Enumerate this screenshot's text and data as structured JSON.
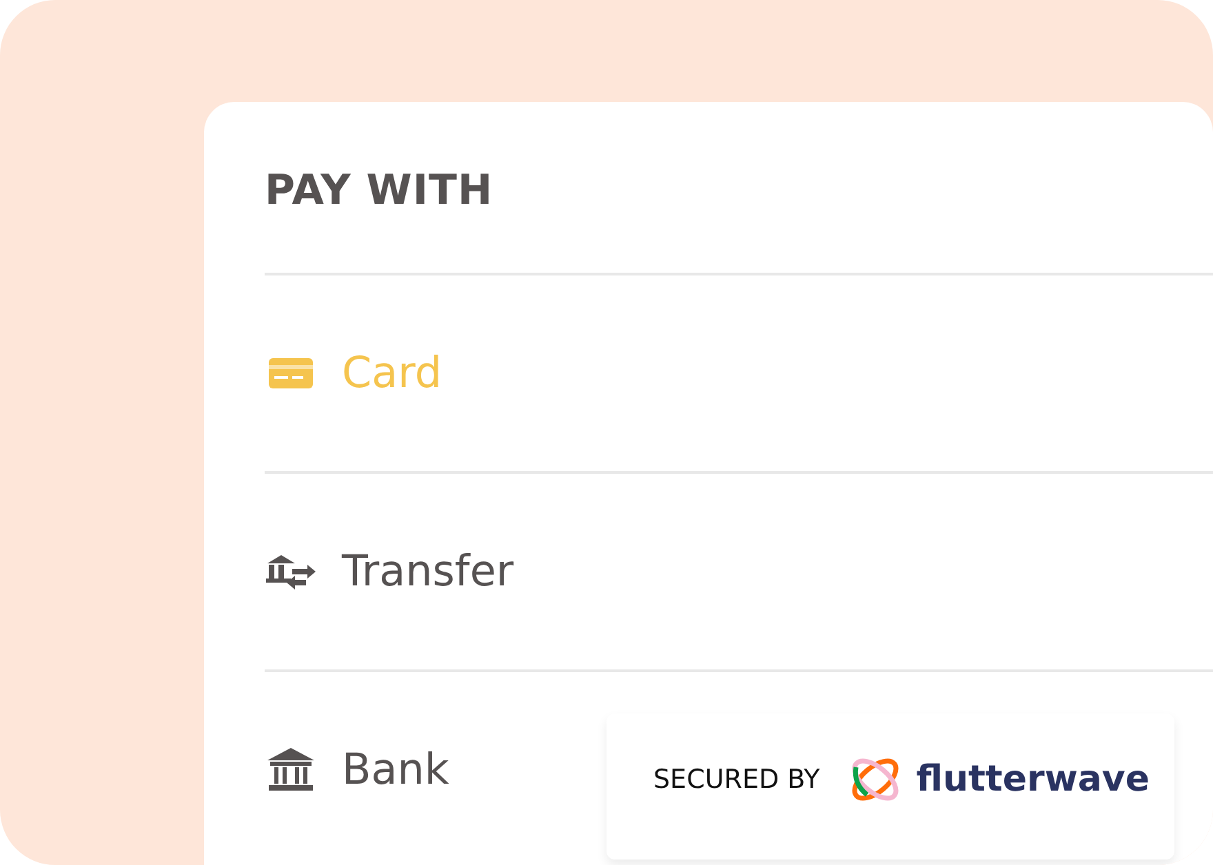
{
  "title": "PAY WITH",
  "methods": [
    {
      "kind": "card",
      "label": "Card",
      "selected": true
    },
    {
      "kind": "transfer",
      "label": "Transfer",
      "selected": false
    },
    {
      "kind": "bank",
      "label": "Bank",
      "selected": false
    }
  ],
  "badge": {
    "label": "SECURED BY",
    "brand": "flutterwave"
  }
}
